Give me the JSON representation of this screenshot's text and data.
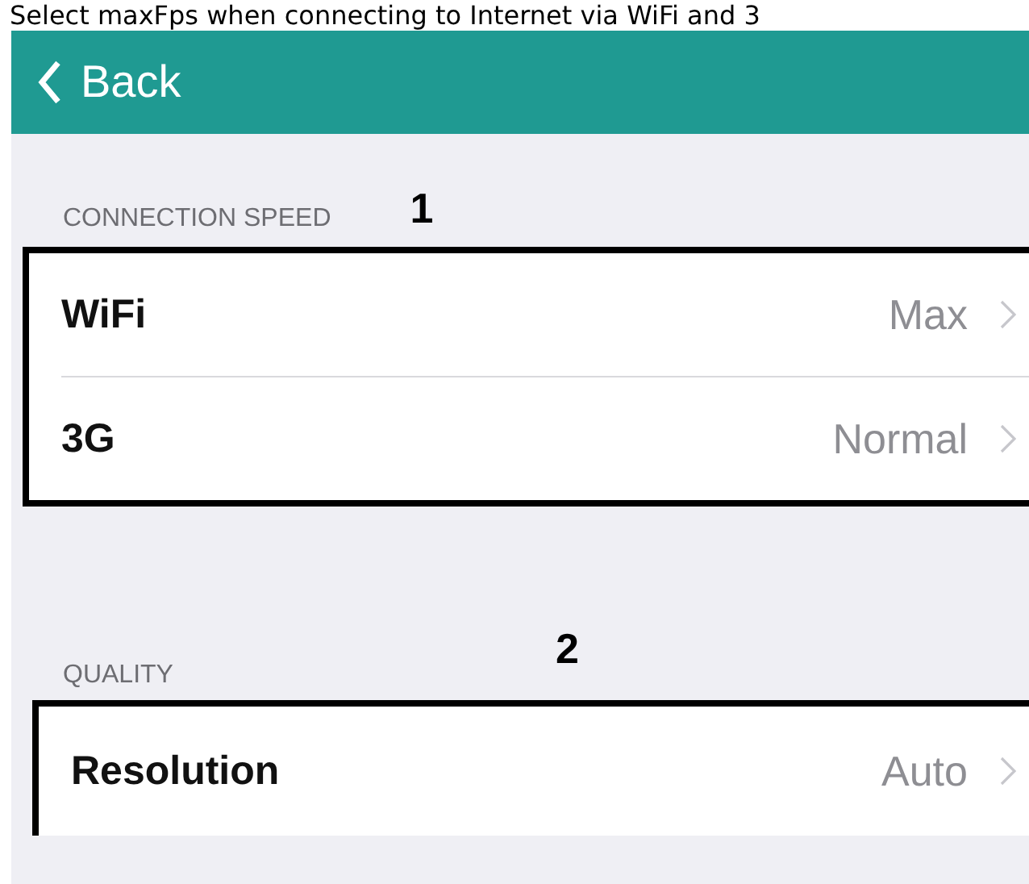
{
  "caption": "Select maxFps when connecting to Internet via WiFi and 3",
  "nav_bar": {
    "back_label": "Back"
  },
  "sections": [
    {
      "header": "CONNECTION SPEED",
      "marker": "1",
      "rows": [
        {
          "label": "WiFi",
          "value": "Max"
        },
        {
          "label": "3G",
          "value": "Normal"
        }
      ]
    },
    {
      "header": "QUALITY",
      "marker": "2",
      "rows": [
        {
          "label": "Resolution",
          "value": "Auto"
        }
      ]
    }
  ]
}
